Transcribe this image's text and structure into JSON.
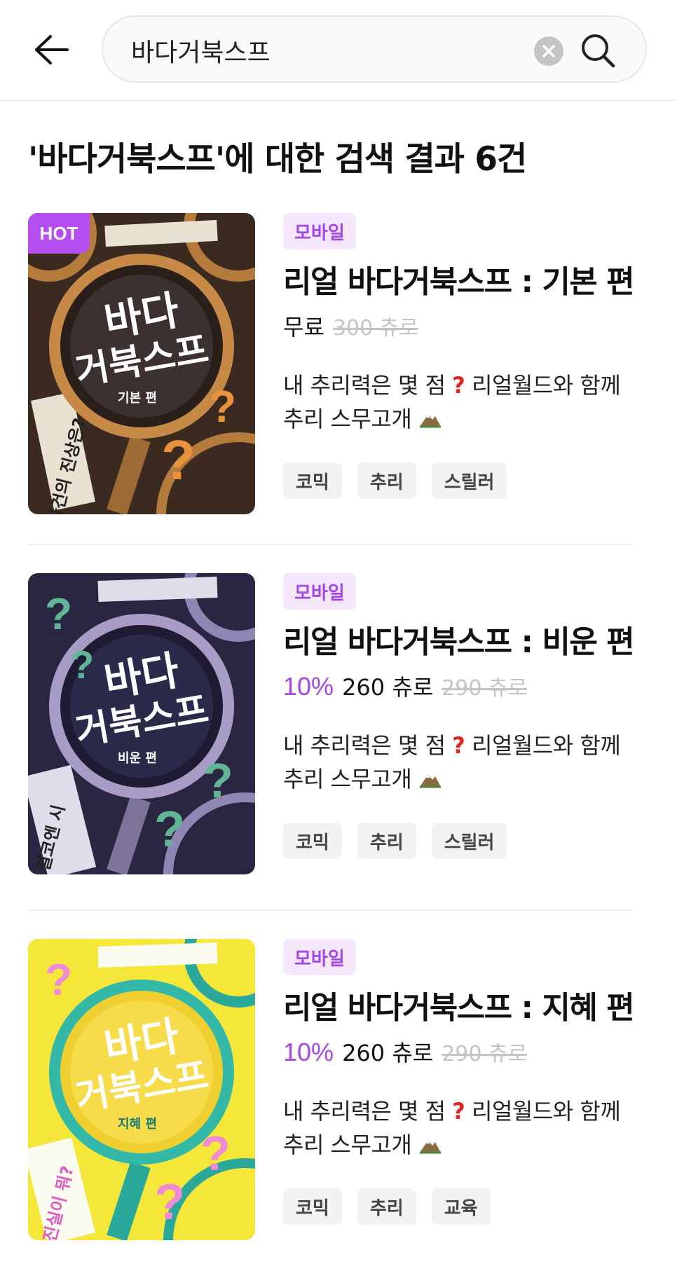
{
  "header": {
    "search_value": "바다거북스프"
  },
  "results": {
    "title": "'바다거북스프'에 대한 검색 결과 6건"
  },
  "items": [
    {
      "hot": "HOT",
      "platform": "모바일",
      "title": "리얼 바다거북스프 : 기본 편",
      "discount": "",
      "price": "무료",
      "original_price": "300 츄로",
      "desc_line1": "내 추리력은 몇 점",
      "desc_line1b": "리얼월드와 함께",
      "desc_line2": "추리 스무고개",
      "cover_title_1": "바다",
      "cover_title_2": "거북스프",
      "cover_sub": "기본 편",
      "cover_side": "사건의 진상은?",
      "tags": [
        "코믹",
        "추리",
        "스릴러"
      ]
    },
    {
      "hot": "",
      "platform": "모바일",
      "title": "리얼 바다거북스프 : 비운 편",
      "discount": "10%",
      "price": "260 츄로",
      "original_price": "290 츄로",
      "desc_line1": "내 추리력은 몇 점",
      "desc_line1b": "리얼월드와 함께",
      "desc_line2": "추리 스무고개",
      "cover_title_1": "바다",
      "cover_title_2": "거북스프",
      "cover_sub": "비운 편",
      "cover_side": "결코엔 시",
      "tags": [
        "코믹",
        "추리",
        "스릴러"
      ]
    },
    {
      "hot": "",
      "platform": "모바일",
      "title": "리얼 바다거북스프 : 지혜 편",
      "discount": "10%",
      "price": "260 츄로",
      "original_price": "290 츄로",
      "desc_line1": "내 추리력은 몇 점",
      "desc_line1b": "리얼월드와 함께",
      "desc_line2": "추리 스무고개",
      "cover_title_1": "바다",
      "cover_title_2": "거북스프",
      "cover_sub": "지혜 편",
      "cover_side": "진실이 뭐?",
      "tags": [
        "코믹",
        "추리",
        "교육"
      ]
    }
  ],
  "icons": {
    "back": "arrow-left-icon",
    "clear": "clear-icon",
    "search": "search-icon",
    "question": "question-mark-icon",
    "mountain": "mountain-icon"
  },
  "colors": {
    "accent": "#a545e6",
    "badge_bg": "#f5e8fd",
    "hot": "#b44ef0",
    "question": "#e02424",
    "strike": "#c4c4c4",
    "tag_bg": "#f2f2f2",
    "cover_basic": "#3a2a1f",
    "cover_biun": "#2a2540",
    "cover_jihye": "#f5e63a"
  }
}
